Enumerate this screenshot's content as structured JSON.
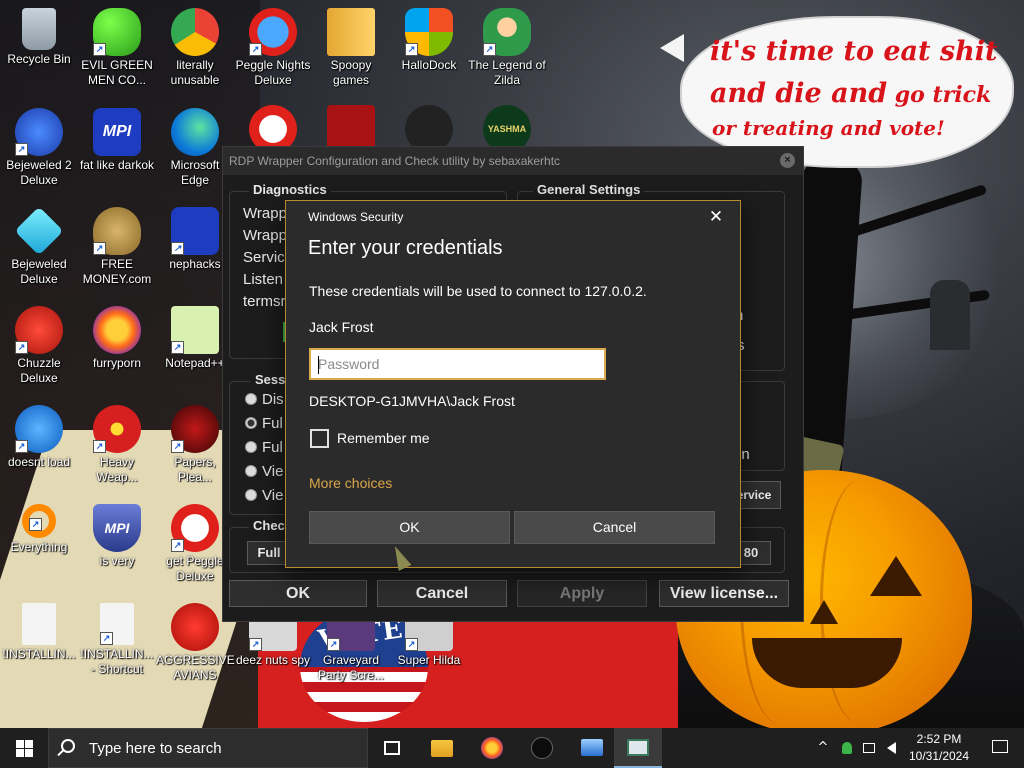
{
  "desktop": {
    "icons": [
      {
        "label": "Recycle Bin"
      },
      {
        "label": "EVIL GREEN MEN CO..."
      },
      {
        "label": "literally unusable"
      },
      {
        "label": "Peggle Nights Deluxe"
      },
      {
        "label": "Spoopy games"
      },
      {
        "label": "HalloDock"
      },
      {
        "label": "The Legend of Zilda"
      },
      {
        "label": "Bejeweled 2 Deluxe"
      },
      {
        "label": "fat like darkok"
      },
      {
        "label": "Microsoft Edge"
      },
      {
        "label": "Bejeweled Deluxe"
      },
      {
        "label": "FREE MONEY.com"
      },
      {
        "label": "nephacks"
      },
      {
        "label": "Chuzzle Deluxe"
      },
      {
        "label": "furryporn"
      },
      {
        "label": "Notepad++"
      },
      {
        "label": "doesnt load"
      },
      {
        "label": "Heavy Weap..."
      },
      {
        "label": "Papers, Plea..."
      },
      {
        "label": "Everything"
      },
      {
        "label": "is very"
      },
      {
        "label": "get Peggle Deluxe"
      },
      {
        "label": "!INSTALLIN..."
      },
      {
        "label": "!INSTALLIN... - Shortcut"
      },
      {
        "label": "AGGRESSIVE AVIANS"
      },
      {
        "label": "deez nuts spy"
      },
      {
        "label": "Graveyard Party Scre..."
      },
      {
        "label": "Super Hilda"
      }
    ],
    "icon_glyphs": {
      "yashma": "YASHMA",
      "mpi1": "MPI",
      "mpi2": "MPI"
    },
    "wallpaper_text": {
      "line1": "it's time to eat shit",
      "line2a": "and die and",
      "line2b": " go trick",
      "line3": "or treating and vote!",
      "vote": "VOTE"
    }
  },
  "rdp_window": {
    "title": "RDP Wrapper Configuration and Check utility by sebaxakerhtc",
    "diagnostics_title": "Diagnostics",
    "diagnostics_lines": [
      "Wrapp",
      "Wrapp",
      "Servic",
      "Listen",
      "termsr"
    ],
    "general_settings_title": "General Settings",
    "general_partial": [
      "n",
      "s",
      "on"
    ],
    "session_title": "Sess",
    "session_options": [
      {
        "label": "Dis",
        "selected": false
      },
      {
        "label": "Ful",
        "selected": true
      },
      {
        "label": "Ful",
        "selected": false
      },
      {
        "label": "Vie",
        "selected": false
      },
      {
        "label": "Vie",
        "selected": false
      }
    ],
    "check_title": "Chec",
    "check_btn": "Full",
    "service_btn": "ervice",
    "port_value": "80",
    "buttons": {
      "ok": "OK",
      "cancel": "Cancel",
      "apply": "Apply",
      "view_license": "View license..."
    }
  },
  "security_dialog": {
    "caption": "Windows Security",
    "heading": "Enter your credentials",
    "description": "These credentials will be used to connect to 127.0.0.2.",
    "username": "Jack Frost",
    "password_placeholder": "Password",
    "password_value": "",
    "domain_user": "DESKTOP-G1JMVHA\\Jack Frost",
    "remember_label": "Remember me",
    "remember_checked": false,
    "more_choices": "More choices",
    "ok_label": "OK",
    "cancel_label": "Cancel",
    "accent_color": "#d8ac4c"
  },
  "taskbar": {
    "search_placeholder": "Type here to search",
    "apps": [
      "task-view-icon",
      "file-explorer-icon",
      "firefox-icon",
      "terminal-icon",
      "remote-desktop-icon",
      "rdp-wrapper-icon"
    ],
    "tray": {
      "chevron": "^",
      "time": "2:52 PM",
      "date": "10/31/2024"
    }
  }
}
